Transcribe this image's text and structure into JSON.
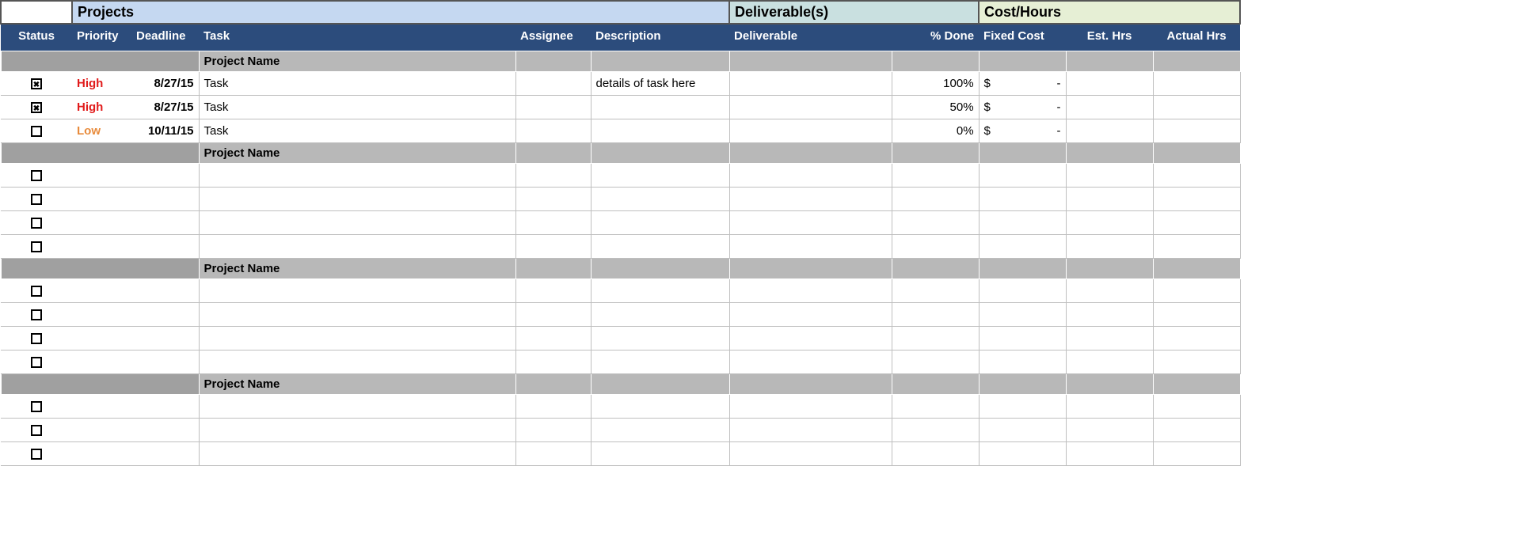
{
  "sections": {
    "projects": "Projects",
    "deliverable": "Deliverable(s)",
    "costhours": "Cost/Hours"
  },
  "columns": {
    "status": "Status",
    "priority": "Priority",
    "deadline": "Deadline",
    "task": "Task",
    "assignee": "Assignee",
    "description": "Description",
    "deliverable": "Deliverable",
    "pctdone": "% Done",
    "fixedcost": "Fixed Cost",
    "esthrs": "Est. Hrs",
    "acthrs": "Actual Hrs"
  },
  "groups": [
    {
      "name": "Project Name",
      "rows": [
        {
          "status": true,
          "priority": "High",
          "deadline": "8/27/15",
          "task": "Task",
          "assignee": "",
          "description": "details of task here",
          "deliverable": "",
          "pctdone": "100%",
          "fixed_currency": "$",
          "fixed_amount": "-",
          "esthrs": "",
          "acthrs": ""
        },
        {
          "status": true,
          "priority": "High",
          "deadline": "8/27/15",
          "task": "Task",
          "assignee": "",
          "description": "",
          "deliverable": "",
          "pctdone": "50%",
          "fixed_currency": "$",
          "fixed_amount": "-",
          "esthrs": "",
          "acthrs": ""
        },
        {
          "status": false,
          "priority": "Low",
          "deadline": "10/11/15",
          "task": "Task",
          "assignee": "",
          "description": "",
          "deliverable": "",
          "pctdone": "0%",
          "fixed_currency": "$",
          "fixed_amount": "-",
          "esthrs": "",
          "acthrs": ""
        }
      ]
    },
    {
      "name": "Project Name",
      "rows": [
        {
          "status": false,
          "priority": "",
          "deadline": "",
          "task": "",
          "assignee": "",
          "description": "",
          "deliverable": "",
          "pctdone": "",
          "fixed_currency": "",
          "fixed_amount": "",
          "esthrs": "",
          "acthrs": ""
        },
        {
          "status": false,
          "priority": "",
          "deadline": "",
          "task": "",
          "assignee": "",
          "description": "",
          "deliverable": "",
          "pctdone": "",
          "fixed_currency": "",
          "fixed_amount": "",
          "esthrs": "",
          "acthrs": ""
        },
        {
          "status": false,
          "priority": "",
          "deadline": "",
          "task": "",
          "assignee": "",
          "description": "",
          "deliverable": "",
          "pctdone": "",
          "fixed_currency": "",
          "fixed_amount": "",
          "esthrs": "",
          "acthrs": ""
        },
        {
          "status": false,
          "priority": "",
          "deadline": "",
          "task": "",
          "assignee": "",
          "description": "",
          "deliverable": "",
          "pctdone": "",
          "fixed_currency": "",
          "fixed_amount": "",
          "esthrs": "",
          "acthrs": ""
        }
      ]
    },
    {
      "name": "Project Name",
      "rows": [
        {
          "status": false,
          "priority": "",
          "deadline": "",
          "task": "",
          "assignee": "",
          "description": "",
          "deliverable": "",
          "pctdone": "",
          "fixed_currency": "",
          "fixed_amount": "",
          "esthrs": "",
          "acthrs": ""
        },
        {
          "status": false,
          "priority": "",
          "deadline": "",
          "task": "",
          "assignee": "",
          "description": "",
          "deliverable": "",
          "pctdone": "",
          "fixed_currency": "",
          "fixed_amount": "",
          "esthrs": "",
          "acthrs": ""
        },
        {
          "status": false,
          "priority": "",
          "deadline": "",
          "task": "",
          "assignee": "",
          "description": "",
          "deliverable": "",
          "pctdone": "",
          "fixed_currency": "",
          "fixed_amount": "",
          "esthrs": "",
          "acthrs": ""
        },
        {
          "status": false,
          "priority": "",
          "deadline": "",
          "task": "",
          "assignee": "",
          "description": "",
          "deliverable": "",
          "pctdone": "",
          "fixed_currency": "",
          "fixed_amount": "",
          "esthrs": "",
          "acthrs": ""
        }
      ]
    },
    {
      "name": "Project Name",
      "rows": [
        {
          "status": false,
          "priority": "",
          "deadline": "",
          "task": "",
          "assignee": "",
          "description": "",
          "deliverable": "",
          "pctdone": "",
          "fixed_currency": "",
          "fixed_amount": "",
          "esthrs": "",
          "acthrs": ""
        },
        {
          "status": false,
          "priority": "",
          "deadline": "",
          "task": "",
          "assignee": "",
          "description": "",
          "deliverable": "",
          "pctdone": "",
          "fixed_currency": "",
          "fixed_amount": "",
          "esthrs": "",
          "acthrs": ""
        },
        {
          "status": false,
          "priority": "",
          "deadline": "",
          "task": "",
          "assignee": "",
          "description": "",
          "deliverable": "",
          "pctdone": "",
          "fixed_currency": "",
          "fixed_amount": "",
          "esthrs": "",
          "acthrs": ""
        }
      ]
    }
  ]
}
